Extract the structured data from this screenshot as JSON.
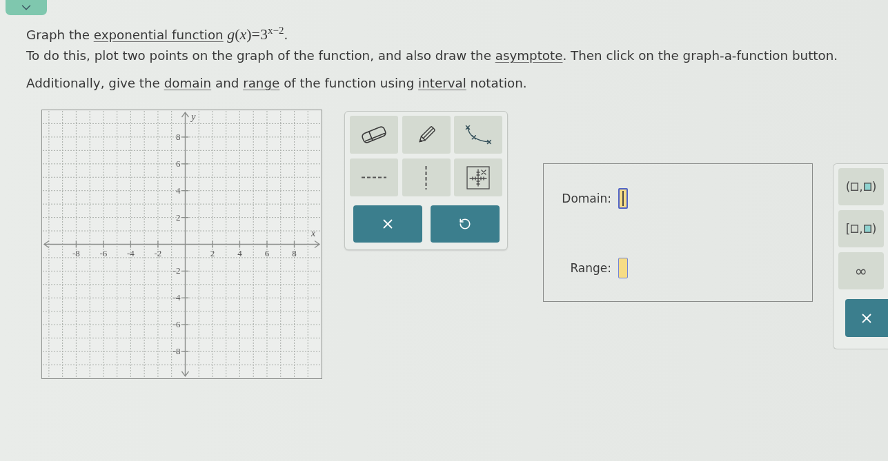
{
  "question": {
    "lines": [
      {
        "parts": [
          {
            "kind": "text",
            "text": "Graph the "
          },
          {
            "kind": "link",
            "text": "exponential function"
          },
          {
            "kind": "math",
            "text": " *g*(*x*)=3$^{x−2}$"
          },
          {
            "kind": "text",
            "text": "."
          }
        ]
      },
      {
        "parts": [
          {
            "kind": "text",
            "text": "To do this, plot two points on the graph of the function, and also draw the "
          },
          {
            "kind": "link",
            "text": "asymptote"
          },
          {
            "kind": "text",
            "text": ". Then click on the graph-a-function button."
          }
        ]
      },
      {
        "parts": [
          {
            "kind": "text",
            "text": "Additionally, give the "
          },
          {
            "kind": "link",
            "text": "domain"
          },
          {
            "kind": "text",
            "text": " and "
          },
          {
            "kind": "link",
            "text": "range"
          },
          {
            "kind": "text",
            "text": " of the function using "
          },
          {
            "kind": "link",
            "text": "interval"
          },
          {
            "kind": "text",
            "text": " notation."
          }
        ]
      }
    ]
  },
  "graph": {
    "chart_data": [
      {
        "type": "scatter",
        "xlabel": "x",
        "ylabel": "y",
        "xlim": [
          -10.5,
          10
        ],
        "ylim": [
          -10,
          10
        ],
        "xticks": [
          -8,
          -6,
          -4,
          -2,
          2,
          4,
          6,
          8
        ],
        "yticks": [
          -8,
          -6,
          -4,
          -2,
          2,
          4,
          6,
          8
        ],
        "grid": true
      }
    ]
  },
  "answers": [
    {
      "label": "Domain:",
      "focused": true
    },
    {
      "label": "Range:",
      "focused": false
    }
  ],
  "palette": [
    {
      "kind": "interval",
      "open": "(",
      "separator": ",",
      "close": ")"
    },
    {
      "kind": "interval",
      "open": "[",
      "separator": ",",
      "close": ")"
    },
    {
      "kind": "symbol",
      "text": "∞"
    }
  ]
}
